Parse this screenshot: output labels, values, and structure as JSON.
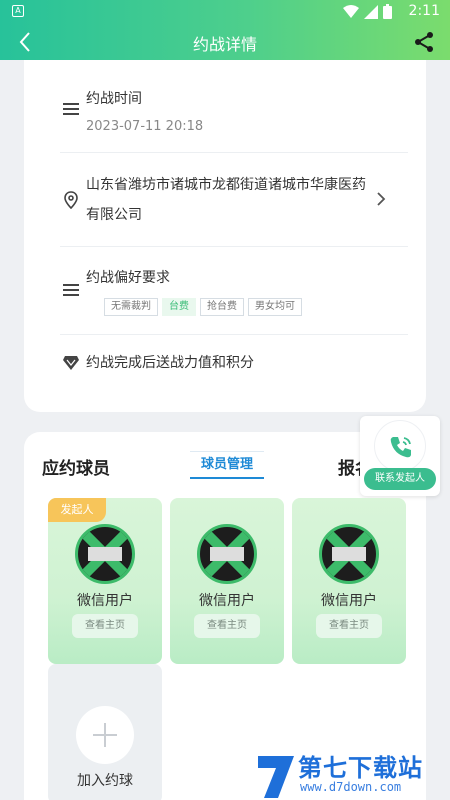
{
  "status_bar": {
    "time": "2:11",
    "app_badge": "A"
  },
  "nav": {
    "title": "约战详情"
  },
  "details": {
    "time_label": "约战时间",
    "time_value": "2023-07-11 20:18",
    "address": "山东省潍坊市诸城市龙都街道诸城市华康医药有限公司",
    "preference_label": "约战偏好要求",
    "tags": [
      {
        "label": "无需裁判",
        "active": false
      },
      {
        "label": "台费",
        "active": true
      },
      {
        "label": "抢台费",
        "active": false
      },
      {
        "label": "男女均可",
        "active": false
      }
    ],
    "reward_text": "约战完成后送战力值和积分"
  },
  "players": {
    "title": "应约球员",
    "manage_label": "球员管理",
    "signup_title": "报名",
    "cards": [
      {
        "badge": "发起人",
        "name": "微信用户",
        "home_label": "查看主页"
      },
      {
        "badge": "",
        "name": "微信用户",
        "home_label": "查看主页"
      },
      {
        "badge": "",
        "name": "微信用户",
        "home_label": "查看主页"
      }
    ],
    "add_label": "加入约球"
  },
  "contact": {
    "label": "联系发起人"
  },
  "watermark": {
    "text": "第七下载站",
    "url": "www.d7down.com"
  },
  "colors": {
    "accent": "#3bbd78",
    "header_start": "#27c29a",
    "header_end": "#7bdc6d",
    "link": "#1e8ad6",
    "badge": "#f7c55a"
  }
}
